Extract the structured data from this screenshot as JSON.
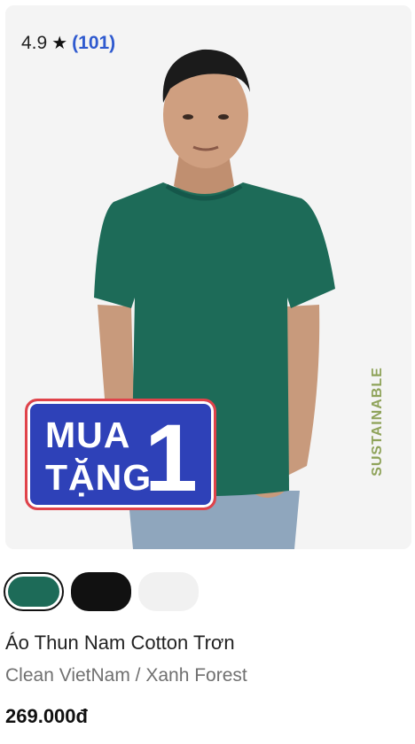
{
  "rating": {
    "score": "4.9",
    "star": "★",
    "count": "(101)"
  },
  "badge": {
    "side_label": "SUSTAINABLE"
  },
  "promo": {
    "line1": "MUA",
    "line2": "TẶNG",
    "number": "1"
  },
  "swatches": [
    {
      "name": "Xanh Forest",
      "color": "#1d6b58",
      "selected": true
    },
    {
      "name": "Black",
      "color": "#111111",
      "selected": false
    },
    {
      "name": "White",
      "color": "#f1f1f1",
      "selected": false
    }
  ],
  "product": {
    "title": "Áo Thun Nam Cotton Trơn",
    "subtitle": "Clean VietNam / Xanh Forest",
    "price": "269.000đ"
  },
  "colors": {
    "accent": "#2f5acf",
    "promo_bg": "#2e41b8",
    "promo_border": "#e0434a",
    "sustainable": "#8fa35a"
  }
}
